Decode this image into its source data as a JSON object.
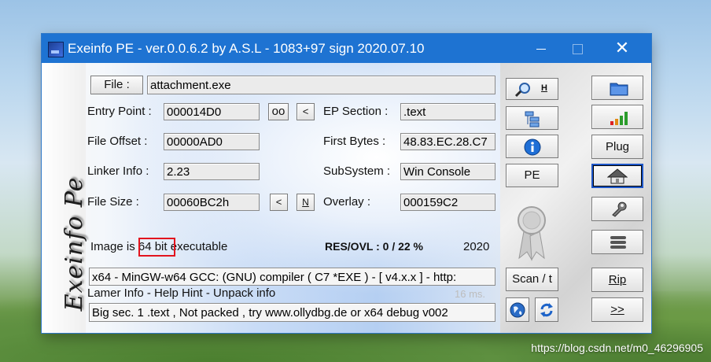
{
  "window": {
    "title": "Exeinfo PE - ver.0.0.6.2  by A.S.L -  1083+97 sign  2020.07.10"
  },
  "brand": "Exeinfo Pe",
  "file": {
    "button_label": "File :",
    "value": "attachment.exe"
  },
  "fields": {
    "entry_point": {
      "label": "Entry Point :",
      "value": "000014D0"
    },
    "file_offset": {
      "label": "File Offset :",
      "value": "00000AD0"
    },
    "linker_info": {
      "label": "Linker Info :",
      "value": "2.23"
    },
    "file_size": {
      "label": "File Size :",
      "value": "00060BC2h"
    },
    "ep_section": {
      "label": "EP Section :",
      "value": ".text"
    },
    "first_bytes": {
      "label": "First Bytes :",
      "value": "48.83.EC.28.C7"
    },
    "subsystem": {
      "label": "SubSystem :",
      "value": "Win Console"
    },
    "overlay": {
      "label": "Overlay :",
      "value": "000159C2"
    }
  },
  "small_buttons": {
    "oo": "oo",
    "lt1": "<",
    "lt2": "<",
    "n": "N"
  },
  "image_info": {
    "prefix": "Image is ",
    "bits": "64 bit",
    "suffix": " executable"
  },
  "res_ovl": "RES/OVL : 0 / 22 %",
  "year": "2020",
  "detect_line": " x64 - MinGW-w64 GCC: (GNU) compiler ( C7 *EXE ) - [ v4.x.x ]  - http:",
  "lamer_info": "Lamer Info - Help Hint - Unpack info",
  "timing": "16 ms.",
  "hint_line": "Big sec. 1 .text , Not packed , try  www.ollydbg.de or x64 debug v002",
  "middle_buttons": {
    "search_hint": "H",
    "pe": "PE",
    "scan": "Scan / t"
  },
  "right_buttons": {
    "plug": "Plug",
    "rip": "Rip",
    "more": ">>"
  },
  "watermark": "https://blog.csdn.net/m0_46296905"
}
